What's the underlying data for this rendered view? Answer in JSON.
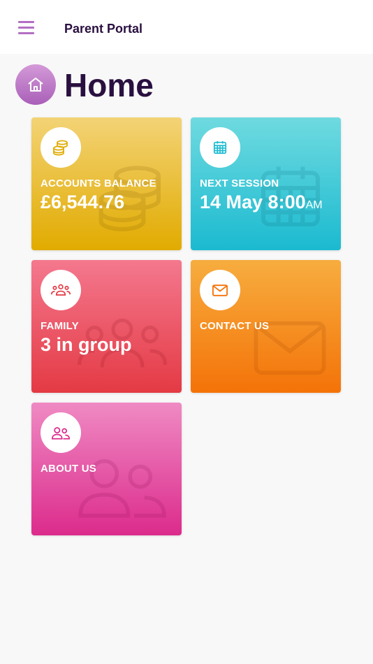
{
  "header": {
    "title": "Parent Portal",
    "menu_icon": "hamburger-menu-icon"
  },
  "page": {
    "title": "Home",
    "icon": "house-icon"
  },
  "tiles": [
    {
      "id": "accounts-balance",
      "label": "ACCOUNTS BALANCE",
      "value": "£6,544.76",
      "icon": "coins-icon",
      "color": "#e1ab00"
    },
    {
      "id": "next-session",
      "label": "NEXT SESSION",
      "value": "14 May 8:00",
      "suffix": "AM",
      "icon": "calendar-icon",
      "color": "#1bbad0"
    },
    {
      "id": "family",
      "label": "FAMILY",
      "value": "3 in group",
      "icon": "group-icon",
      "color": "#e43a44"
    },
    {
      "id": "contact-us",
      "label": "CONTACT US",
      "icon": "envelope-icon",
      "color": "#f47308"
    },
    {
      "id": "about-us",
      "label": "ABOUT US",
      "icon": "users-icon",
      "color": "#dc2b8c"
    }
  ]
}
